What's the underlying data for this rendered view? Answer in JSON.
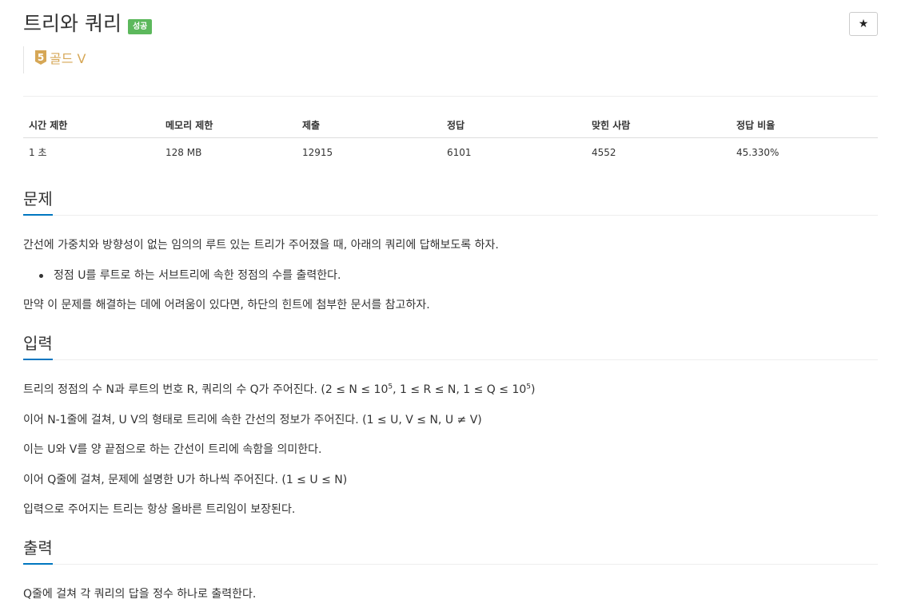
{
  "header": {
    "title": "트리와 쿼리",
    "status_badge": "성공",
    "star_icon": "★",
    "tier_number": "5",
    "tier_label": "골드 V"
  },
  "colors": {
    "success": "#5cb85c",
    "tier_gold": "#d6a756",
    "section_underline": "#0076c0"
  },
  "info_table": {
    "headers": [
      "시간 제한",
      "메모리 제한",
      "제출",
      "정답",
      "맞힌 사람",
      "정답 비율"
    ],
    "values": [
      "1 초",
      "128 MB",
      "12915",
      "6101",
      "4552",
      "45.330%"
    ]
  },
  "problem": {
    "title": "문제",
    "para1": "간선에 가중치와 방향성이 없는 임의의 루트 있는 트리가 주어졌을 때, 아래의 쿼리에 답해보도록 하자.",
    "bullet1": "정점 U를 루트로 하는 서브트리에 속한 정점의 수를 출력한다.",
    "para2": "만약 이 문제를 해결하는 데에 어려움이 있다면, 하단의 힌트에 첨부한 문서를 참고하자."
  },
  "input": {
    "title": "입력",
    "line1_prefix": "트리의 정점의 수 N과 루트의 번호 R, 쿼리의 수 Q가 주어진다. (2 ≤ N ≤ 10",
    "line1_exp1": "5",
    "line1_mid": ", 1 ≤ R ≤ N, 1 ≤ Q ≤ 10",
    "line1_exp2": "5",
    "line1_suffix": ")",
    "line2": "이어 N-1줄에 걸쳐, U V의 형태로 트리에 속한 간선의 정보가 주어진다. (1 ≤ U, V ≤ N, U ≠ V)",
    "line3": "이는 U와 V를 양 끝점으로 하는 간선이 트리에 속함을 의미한다.",
    "line4": "이어 Q줄에 걸쳐, 문제에 설명한 U가 하나씩 주어진다. (1 ≤ U ≤ N)",
    "line5": "입력으로 주어지는 트리는 항상 올바른 트리임이 보장된다."
  },
  "output": {
    "title": "출력",
    "line1": "Q줄에 걸쳐 각 쿼리의 답을 정수 하나로 출력한다."
  }
}
